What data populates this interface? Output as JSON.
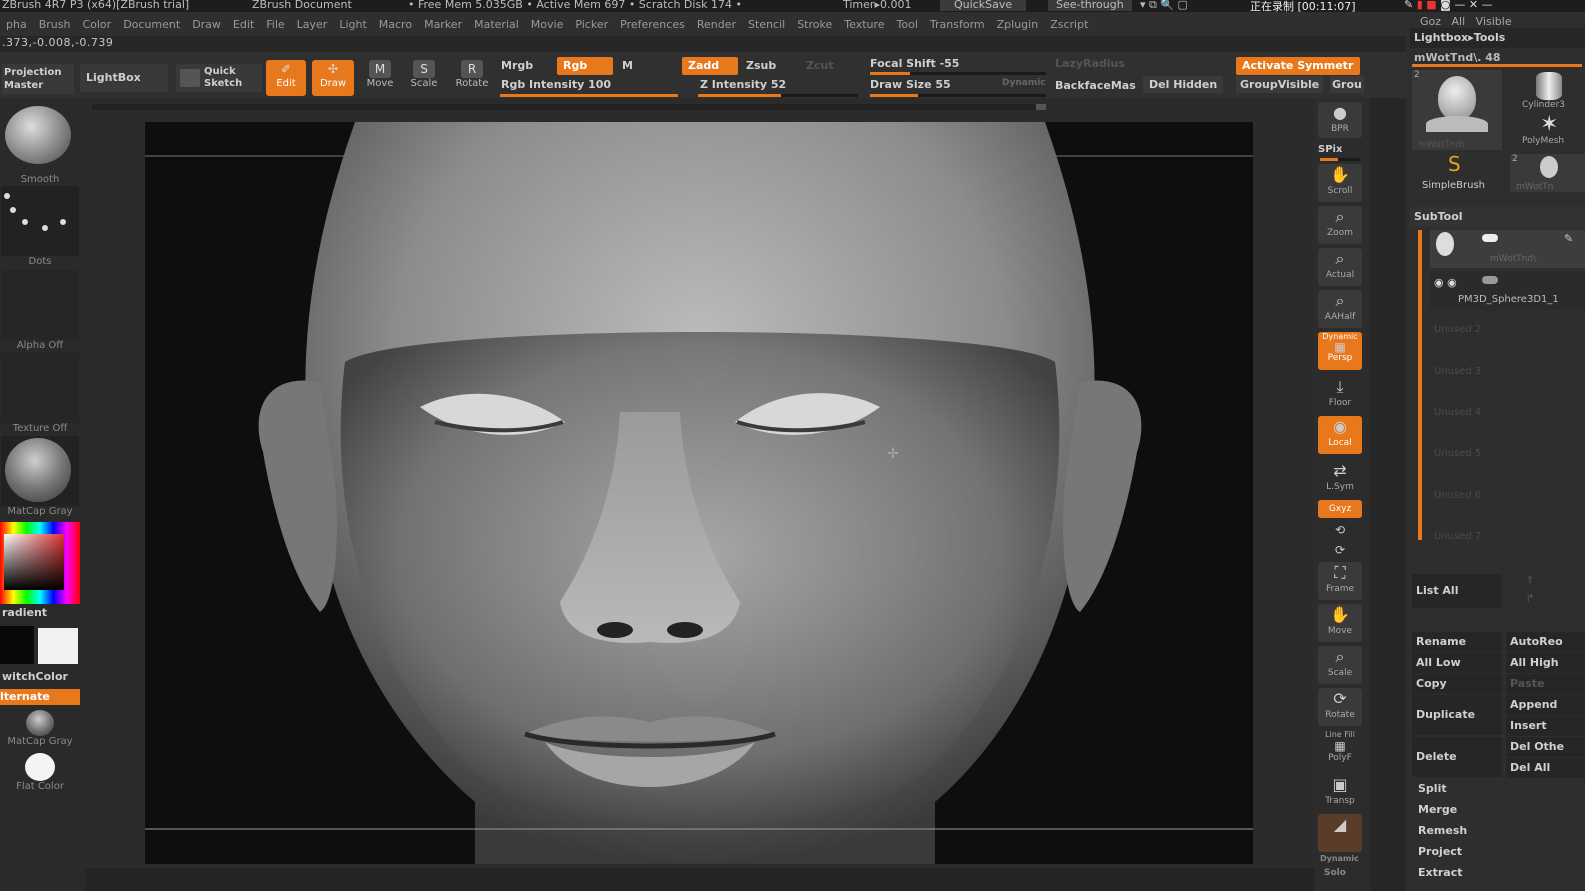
{
  "titlebar": {
    "app_title": "ZBrush 4R7 P3 (x64)[ZBrush trial]",
    "doc_label": "ZBrush Document",
    "free_mem": "• Free Mem 5.035GB • Active Mem 697 • Scratch Disk 174 •",
    "timer": "Timer▸0.001",
    "quicksave": "QuickSave",
    "see_through": "See-through",
    "recording": "正在录制 [00:11:07]"
  },
  "menu": [
    "pha",
    "Brush",
    "Color",
    "Document",
    "Draw",
    "Edit",
    "File",
    "Layer",
    "Light",
    "Macro",
    "Marker",
    "Material",
    "Movie",
    "Picker",
    "Preferences",
    "Render",
    "Stencil",
    "Stroke",
    "Texture",
    "Tool",
    "Transform",
    "Zplugin",
    "Zscript"
  ],
  "coords": ".373,-0.008,-0.739",
  "toolbar": {
    "projection_master": "Projection Master",
    "lightbox": "LightBox",
    "quick_sketch": "Quick Sketch",
    "edit": "Edit",
    "draw": "Draw",
    "move": "Move",
    "scale": "Scale",
    "rotate": "Rotate",
    "mrgb": "Mrgb",
    "rgb": "Rgb",
    "m": "M",
    "zadd": "Zadd",
    "zsub": "Zsub",
    "zcut": "Zcut",
    "rgb_intensity": "Rgb Intensity 100",
    "z_intensity": "Z Intensity 52",
    "focal_shift": "Focal Shift -55",
    "draw_size": "Draw Size 55",
    "dynamic": "Dynamic",
    "lazy_radius": "LazyRadius",
    "backface": "BackfaceMas",
    "del_hidden": "Del Hidden",
    "activate_symmetry": "Activate Symmetr",
    "group_visible": "GroupVisible",
    "grou": "Grou",
    "rgb_intensity_value": 100,
    "z_intensity_value": 52,
    "draw_size_value": 55,
    "focal_shift_value": -55
  },
  "left": {
    "smooth": "Smooth",
    "dots": "Dots",
    "alpha": "Alpha Off",
    "texture": "Texture Off",
    "matcap": "MatCap Gray",
    "gradient": "radient",
    "switch_color": "witchColor",
    "alternate": "lternate",
    "matcap2": "MatCap Gray",
    "flat_color": "Flat Color"
  },
  "right": {
    "bpr": "BPR",
    "spix": "SPix",
    "scroll": "Scroll",
    "zoom": "Zoom",
    "actual": "Actual",
    "aahalf": "AAHalf",
    "dynamic": "Dynamic",
    "persp": "Persp",
    "floor": "Floor",
    "local": "Local",
    "lsym": "L.Sym",
    "xyz": "Gxyz",
    "frame": "Frame",
    "move": "Move",
    "scale": "Scale",
    "rotate": "Rotate",
    "line_fill": "Line Fill",
    "polyf": "PolyF",
    "transp": "Transp",
    "dynamic2": "Dynamic",
    "solo": "Solo"
  },
  "side": {
    "top_labels": [
      "Goz",
      "All",
      "Visible"
    ],
    "lightbox_tools": "Lightbox▸Tools",
    "tool_name": "mWotTnd\\. 48",
    "tool_thumbs": [
      "mWotTnd\\",
      "Cylinder3",
      "PolyMesh",
      "SimpleBrush",
      "mWotTn"
    ],
    "thumb_count_a": "2",
    "thumb_count_b": "2",
    "subtool": "SubTool",
    "subtool_1": "mWotTnd\\",
    "subtool_2": "PM3D_Sphere3D1_1",
    "unused": [
      "Unused 2",
      "Unused 3",
      "Unused 4",
      "Unused 5",
      "Unused 6",
      "Unused 7"
    ],
    "list_all": "List All",
    "rename": "Rename",
    "autoreo": "AutoReo",
    "all_low": "All Low",
    "all_high": "All High",
    "copy": "Copy",
    "paste": "Paste",
    "duplicate": "Duplicate",
    "append": "Append",
    "insert": "Insert",
    "delete": "Delete",
    "del_other": "Del Othe",
    "del_all": "Del All",
    "split": "Split",
    "merge": "Merge",
    "remesh": "Remesh",
    "project": "Project",
    "extract": "Extract"
  },
  "colors": {
    "accent": "#e8781c",
    "panel": "#2e2e2e",
    "canvas": "#0e0e0e"
  }
}
